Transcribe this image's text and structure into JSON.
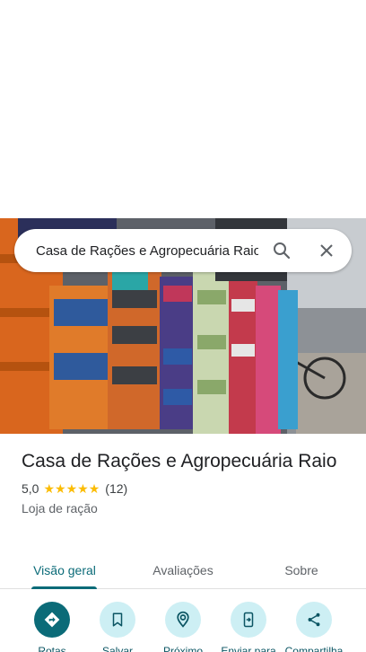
{
  "search": {
    "query": "Casa de Rações e Agropecuária Raio",
    "search_icon": "search-icon",
    "close_icon": "close-icon"
  },
  "place": {
    "name": "Casa de Rações e Agropecuária Raio",
    "rating": "5,0",
    "stars": 5,
    "reviews": "(12)",
    "category": "Loja de ração"
  },
  "tabs": [
    {
      "label": "Visão geral",
      "active": true
    },
    {
      "label": "Avaliações",
      "active": false
    },
    {
      "label": "Sobre",
      "active": false
    }
  ],
  "actions": [
    {
      "label": "Rotas",
      "icon": "directions-icon"
    },
    {
      "label": "Salvar",
      "icon": "bookmark-icon"
    },
    {
      "label": "Próximo",
      "icon": "nearby-icon"
    },
    {
      "label": "Enviar para",
      "icon": "send-to-phone-icon"
    },
    {
      "label": "Compartilha",
      "icon": "share-icon"
    }
  ],
  "colors": {
    "accent": "#0b6b78",
    "action_bg": "#cdeff4",
    "star": "#fbbc04"
  }
}
